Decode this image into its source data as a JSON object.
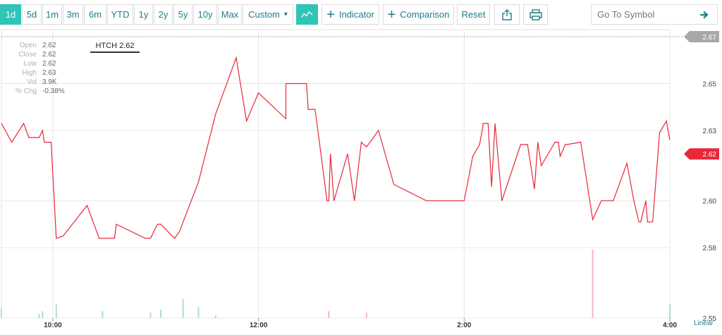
{
  "toolbar": {
    "ranges": [
      {
        "label": "1d",
        "active": true
      },
      {
        "label": "5d",
        "active": false
      },
      {
        "label": "1m",
        "active": false
      },
      {
        "label": "3m",
        "active": false
      },
      {
        "label": "6m",
        "active": false
      },
      {
        "label": "YTD",
        "active": false
      },
      {
        "label": "1y",
        "active": false
      },
      {
        "label": "2y",
        "active": false
      },
      {
        "label": "5y",
        "active": false
      },
      {
        "label": "10y",
        "active": false
      },
      {
        "label": "Max",
        "active": false
      }
    ],
    "custom_label": "Custom",
    "indicator_label": "Indicator",
    "comparison_label": "Comparison",
    "reset_label": "Reset",
    "search_placeholder": "Go To Symbol"
  },
  "legend": {
    "symbol_tag": "HTCH 2.62",
    "rows": [
      {
        "key": "Open",
        "value": "2.62"
      },
      {
        "key": "Close",
        "value": "2.62"
      },
      {
        "key": "Low",
        "value": "2.62"
      },
      {
        "key": "High",
        "value": "2.63"
      },
      {
        "key": "Vol",
        "value": "3.9K"
      },
      {
        "key": "% Chg",
        "value": "-0.38%"
      }
    ]
  },
  "scale_label": "Linear",
  "colors": {
    "accent": "#2ec4b6",
    "line": "#e8273a",
    "last_price": "#e8273a",
    "prev_close": "#a8a8a8",
    "volume_up": "#a6e3cc",
    "volume_down": "#f5b7bd"
  },
  "chart_data": {
    "type": "line",
    "title": "",
    "xlabel": "",
    "ylabel": "",
    "x_ticks": [
      {
        "t": 30,
        "label": "10:00"
      },
      {
        "t": 150,
        "label": "12:00"
      },
      {
        "t": 270,
        "label": "2:00"
      },
      {
        "t": 390,
        "label": "4:00"
      }
    ],
    "x_range_minutes": [
      0,
      390
    ],
    "y_ticks": [
      2.55,
      2.58,
      2.6,
      2.63,
      2.65,
      2.67
    ],
    "ylim": [
      2.55,
      2.673
    ],
    "prev_close": 2.67,
    "last_price": 2.62,
    "series": [
      {
        "t": [
          0,
          6,
          13,
          16,
          22,
          24,
          25,
          29,
          32,
          36,
          50,
          57,
          59,
          66,
          67,
          84,
          87,
          91,
          93,
          101,
          104,
          106,
          115,
          125,
          137,
          143,
          150,
          166,
          166,
          170,
          172,
          178,
          179,
          183,
          185,
          190,
          191,
          192,
          194,
          202,
          206,
          210,
          213,
          220,
          229,
          248,
          252,
          256,
          257,
          270,
          275,
          279,
          281,
          281,
          284,
          286,
          288,
          292,
          303,
          307,
          311,
          313,
          315,
          323,
          325,
          326,
          329,
          330,
          338,
          345,
          350,
          357,
          362,
          365,
          369,
          372,
          373,
          376,
          377,
          380,
          384,
          388,
          390
        ],
        "values": [
          2.633,
          2.625,
          2.633,
          2.627,
          2.627,
          2.63,
          2.625,
          2.625,
          2.584,
          2.585,
          2.598,
          2.584,
          2.584,
          2.584,
          2.59,
          2.584,
          2.584,
          2.59,
          2.59,
          2.584,
          2.587,
          2.591,
          2.608,
          2.637,
          2.661,
          2.634,
          2.646,
          2.635,
          2.65,
          2.65,
          2.65,
          2.65,
          2.639,
          2.639,
          2.628,
          2.6,
          2.6,
          2.62,
          2.6,
          2.62,
          2.6,
          2.625,
          2.623,
          2.63,
          2.607,
          2.6,
          2.6,
          2.6,
          2.6,
          2.6,
          2.619,
          2.624,
          2.632,
          2.633,
          2.633,
          2.606,
          2.633,
          2.6,
          2.624,
          2.624,
          2.605,
          2.625,
          2.615,
          2.625,
          2.625,
          2.619,
          2.624,
          2.624,
          2.625,
          2.592,
          2.6,
          2.6,
          2.61,
          2.616,
          2.6,
          2.591,
          2.591,
          2.6,
          2.591,
          2.591,
          2.629,
          2.634,
          2.626
        ],
        "volume": [
          14,
          0,
          0,
          0,
          6,
          10,
          0,
          0,
          20,
          0,
          0,
          0,
          10,
          0,
          0,
          0,
          8,
          0,
          12,
          0,
          0,
          28,
          16,
          4,
          0,
          0,
          0,
          0,
          0,
          0,
          0,
          0,
          0,
          0,
          0,
          0,
          10,
          0,
          0,
          0,
          0,
          0,
          8,
          0,
          0,
          0,
          0,
          0,
          0,
          0,
          0,
          0,
          0,
          0,
          0,
          0,
          0,
          0,
          0,
          0,
          0,
          0,
          0,
          0,
          0,
          0,
          0,
          0,
          0,
          100,
          0,
          0,
          0,
          0,
          0,
          0,
          0,
          0,
          0,
          0,
          0,
          0,
          20
        ],
        "volume_dir": [
          "up",
          "up",
          "up",
          "up",
          "up",
          "up",
          "up",
          "up",
          "up",
          "up",
          "up",
          "up",
          "up",
          "up",
          "up",
          "up",
          "up",
          "up",
          "up",
          "up",
          "up",
          "up",
          "up",
          "up",
          "up",
          "up",
          "up",
          "up",
          "up",
          "up",
          "up",
          "up",
          "up",
          "up",
          "up",
          "up",
          "down",
          "up",
          "up",
          "up",
          "up",
          "up",
          "down",
          "up",
          "up",
          "up",
          "up",
          "up",
          "up",
          "up",
          "up",
          "up",
          "up",
          "up",
          "up",
          "up",
          "up",
          "up",
          "up",
          "up",
          "up",
          "up",
          "up",
          "up",
          "up",
          "up",
          "up",
          "up",
          "up",
          "down",
          "up",
          "up",
          "up",
          "up",
          "up",
          "up",
          "up",
          "up",
          "up",
          "up",
          "up",
          "up",
          "up"
        ]
      }
    ],
    "grid": true
  }
}
